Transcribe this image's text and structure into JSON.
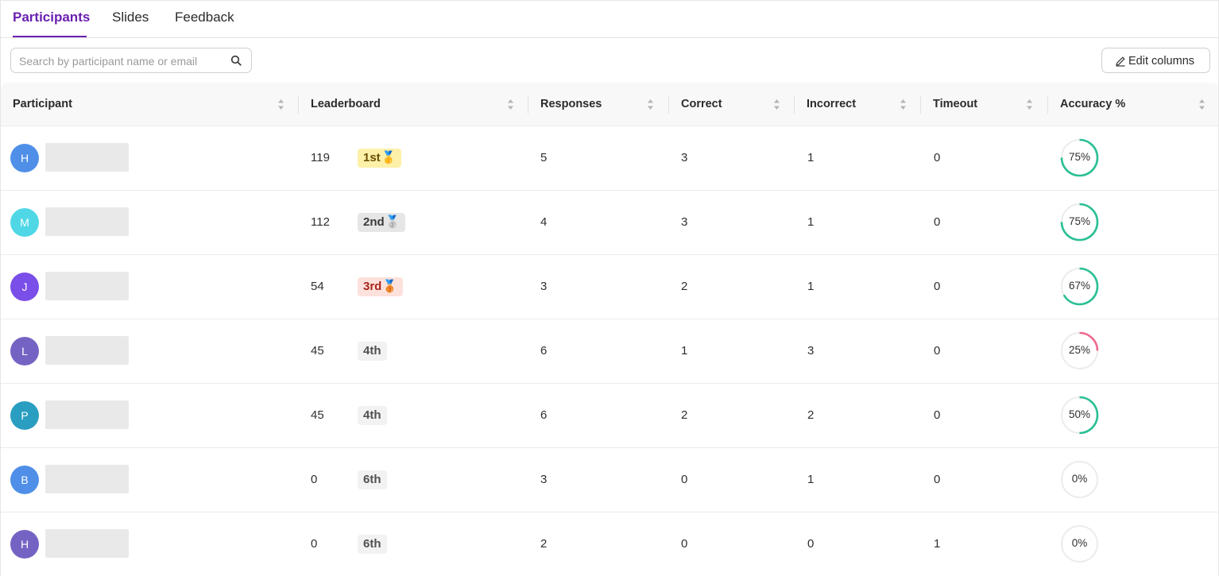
{
  "tabs": [
    {
      "label": "Participants",
      "active": true
    },
    {
      "label": "Slides",
      "active": false
    },
    {
      "label": "Feedback",
      "active": false
    }
  ],
  "toolbar": {
    "search_placeholder": "Search by participant name or email",
    "search_value": "",
    "edit_columns_label": "Edit columns"
  },
  "columns": [
    {
      "label": "Participant"
    },
    {
      "label": "Leaderboard"
    },
    {
      "label": "Responses"
    },
    {
      "label": "Correct"
    },
    {
      "label": "Incorrect"
    },
    {
      "label": "Timeout"
    },
    {
      "label": "Accuracy %"
    }
  ],
  "colors": {
    "accent": "#6a1fb0",
    "ring_good": "#2bbf95",
    "ring_bad": "#ee6a8e",
    "ring_track": "#ececec"
  },
  "rows": [
    {
      "initial": "H",
      "avatar_color": "#4f8fe8",
      "score": "119",
      "rank": "1st",
      "medal": "🥇",
      "rank_style": "gold",
      "responses": "5",
      "correct": "3",
      "incorrect": "1",
      "timeout": "0",
      "accuracy": 0.75,
      "accuracy_label": "75%"
    },
    {
      "initial": "M",
      "avatar_color": "#4fd7e6",
      "score": "112",
      "rank": "2nd",
      "medal": "🥈",
      "rank_style": "silver",
      "responses": "4",
      "correct": "3",
      "incorrect": "1",
      "timeout": "0",
      "accuracy": 0.75,
      "accuracy_label": "75%"
    },
    {
      "initial": "J",
      "avatar_color": "#7a4ee8",
      "score": "54",
      "rank": "3rd",
      "medal": "🥉",
      "rank_style": "bronze",
      "responses": "3",
      "correct": "2",
      "incorrect": "1",
      "timeout": "0",
      "accuracy": 0.67,
      "accuracy_label": "67%"
    },
    {
      "initial": "L",
      "avatar_color": "#7563c4",
      "score": "45",
      "rank": "4th",
      "medal": "",
      "rank_style": "plain",
      "responses": "6",
      "correct": "1",
      "incorrect": "3",
      "timeout": "0",
      "accuracy": 0.25,
      "accuracy_label": "25%"
    },
    {
      "initial": "P",
      "avatar_color": "#2a9ec0",
      "score": "45",
      "rank": "4th",
      "medal": "",
      "rank_style": "plain",
      "responses": "6",
      "correct": "2",
      "incorrect": "2",
      "timeout": "0",
      "accuracy": 0.5,
      "accuracy_label": "50%"
    },
    {
      "initial": "B",
      "avatar_color": "#4f8fe8",
      "score": "0",
      "rank": "6th",
      "medal": "",
      "rank_style": "plain",
      "responses": "3",
      "correct": "0",
      "incorrect": "1",
      "timeout": "0",
      "accuracy": 0,
      "accuracy_label": "0%"
    },
    {
      "initial": "H",
      "avatar_color": "#7563c4",
      "score": "0",
      "rank": "6th",
      "medal": "",
      "rank_style": "plain",
      "responses": "2",
      "correct": "0",
      "incorrect": "0",
      "timeout": "1",
      "accuracy": 0,
      "accuracy_label": "0%"
    }
  ]
}
